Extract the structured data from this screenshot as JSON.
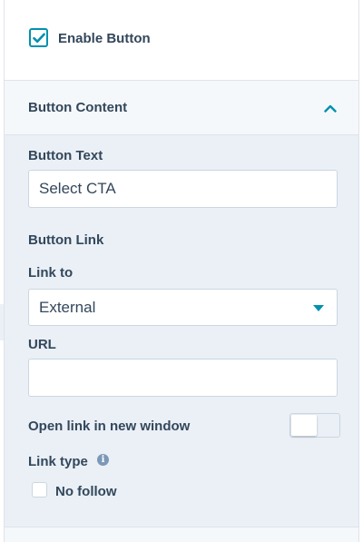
{
  "enable_button": {
    "label": "Enable Button",
    "checked": true
  },
  "section": {
    "title": "Button Content",
    "expanded": true
  },
  "button_text": {
    "label": "Button Text",
    "value": "Select CTA"
  },
  "button_link": {
    "heading": "Button Link"
  },
  "link_to": {
    "label": "Link to",
    "selected": "External"
  },
  "url": {
    "label": "URL",
    "value": ""
  },
  "new_window": {
    "label": "Open link in new window",
    "enabled": false
  },
  "link_type": {
    "label": "Link type",
    "info_icon": "info-icon"
  },
  "no_follow": {
    "label": "No follow",
    "checked": false
  },
  "colors": {
    "accent": "#0091ae",
    "text": "#33475b",
    "panel_bg": "#eaf0f6",
    "border": "#cbd6e2"
  }
}
